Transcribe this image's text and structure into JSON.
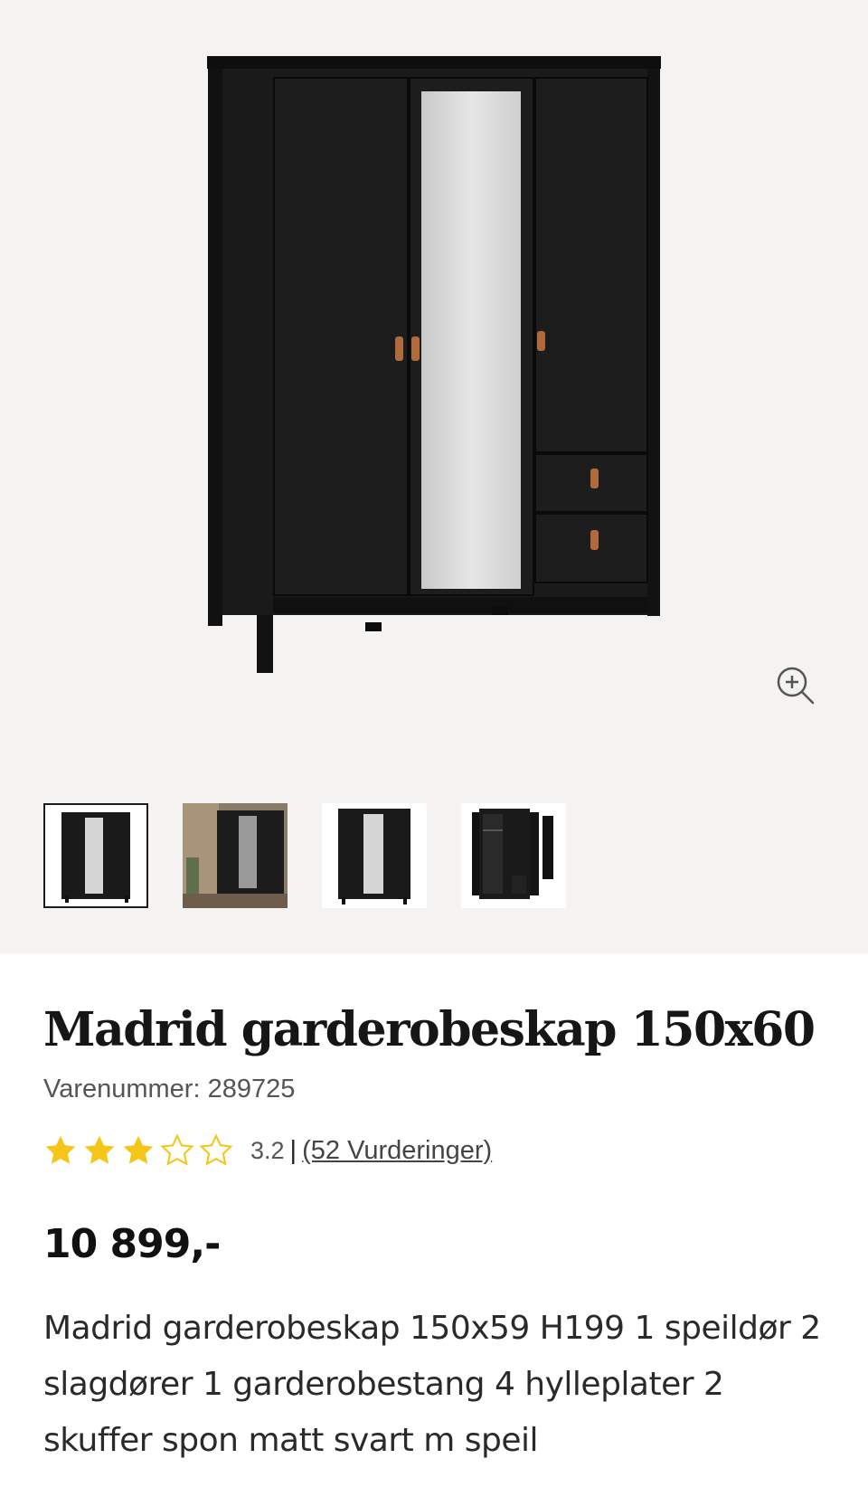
{
  "product": {
    "title": "Madrid garderobeskap 150x60",
    "sku_label": "Varenummer: 289725",
    "rating_value": "3.2",
    "rating_separator": "|",
    "rating_link": "(52 Vurderinger)",
    "rating": 3.2,
    "rating_max": 5,
    "price": "10 899,-",
    "description": "Madrid garderobeskap 150x59 H199 1 speildør 2 slagdører 1 garderobestang 4 hylleplater 2 skuffer spon matt svart m speil"
  },
  "gallery": {
    "selected_index": 0,
    "thumbnails": [
      "wardrobe-front",
      "wardrobe-room",
      "wardrobe-front-plain",
      "wardrobe-open"
    ]
  },
  "colors": {
    "gallery_bg": "#f4f3f1",
    "star_filled": "#f5c518",
    "star_empty_outline": "#f5c518",
    "wardrobe": "#141414",
    "leather_handle": "#b06a3b",
    "mirror": "#d9d9d9"
  },
  "icons": {
    "zoom": "zoom-in-icon",
    "star_filled": "star-filled-icon",
    "star_empty": "star-outline-icon"
  }
}
